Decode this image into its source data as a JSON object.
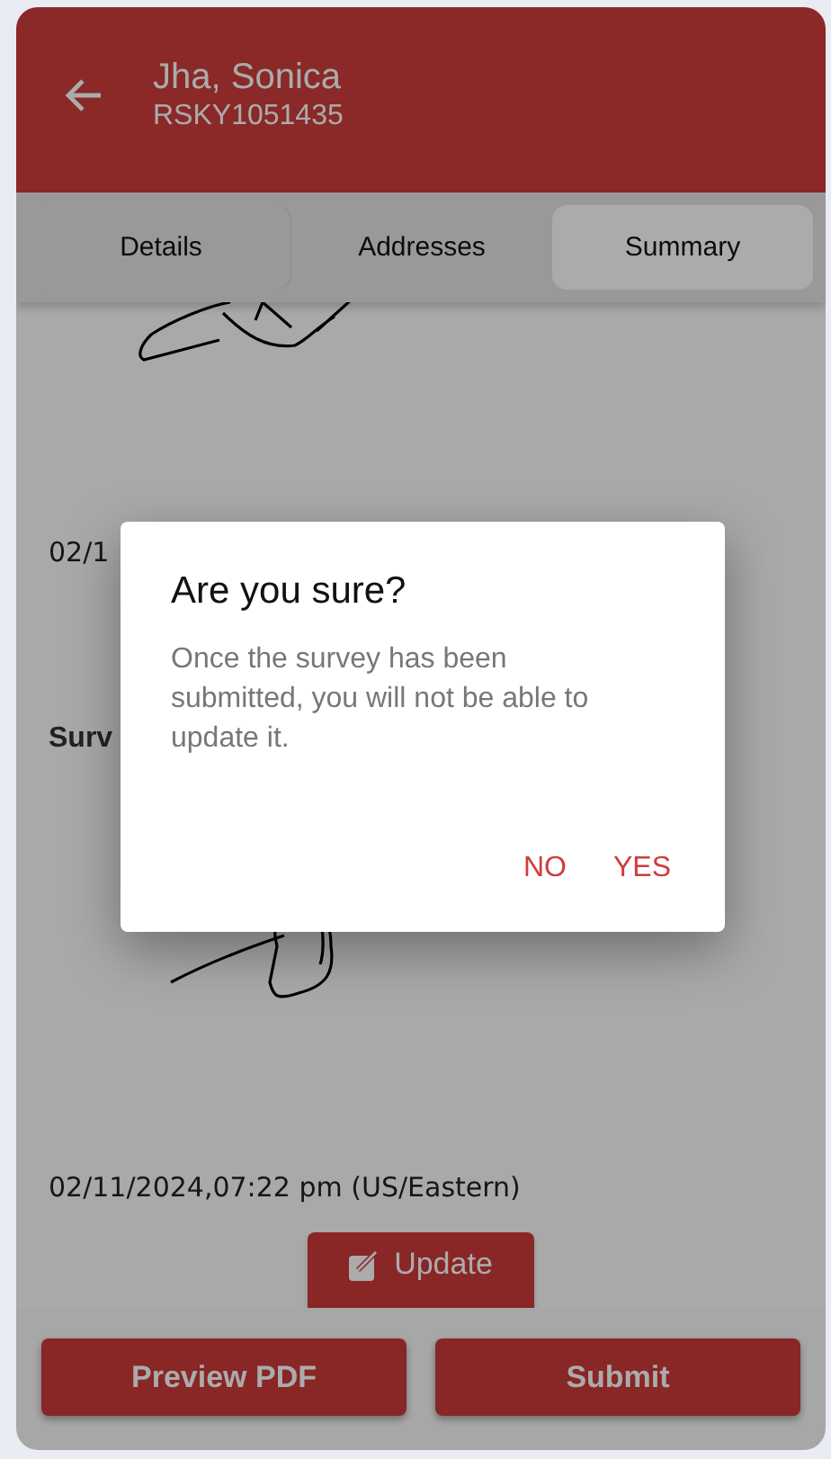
{
  "header": {
    "title": "Jha, Sonica",
    "subtitle": "RSKY1051435"
  },
  "tabs": [
    {
      "label": "Details",
      "selected": false
    },
    {
      "label": "Addresses",
      "selected": false
    },
    {
      "label": "Summary",
      "selected": true
    }
  ],
  "content": [
    {
      "kind": "signature"
    },
    {
      "kind": "date",
      "text": "02/1"
    },
    {
      "kind": "heading",
      "text": "Surv"
    },
    {
      "kind": "signature"
    },
    {
      "kind": "date",
      "text": "02/11/2024,07:22 pm (US/Eastern)"
    },
    {
      "kind": "button",
      "label": "Update"
    }
  ],
  "footer": {
    "buttons": [
      "Preview PDF",
      "Submit"
    ]
  },
  "dialog": {
    "title": "Are you sure?",
    "message": "Once the survey has been submitted, you will not be able to update it.",
    "actions": [
      "NO",
      "YES"
    ]
  }
}
